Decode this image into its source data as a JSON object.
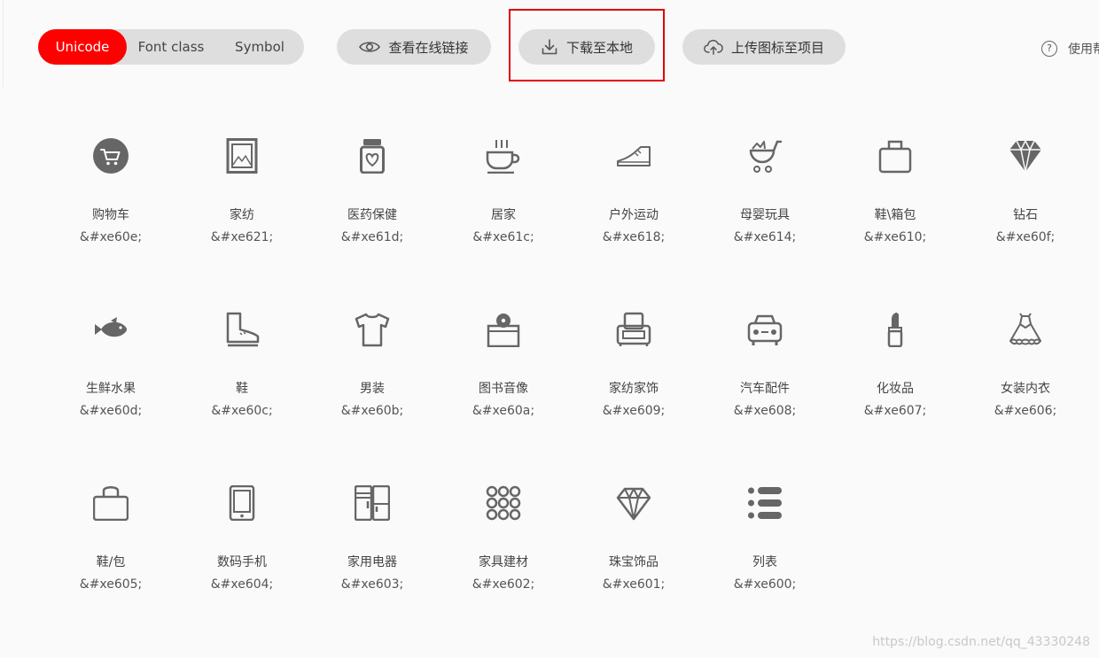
{
  "tabs": [
    "Unicode",
    "Font class",
    "Symbol"
  ],
  "active_tab": "Unicode",
  "actions": {
    "view_online_link": "查看在线链接",
    "download_local": "下载至本地",
    "upload_to_project": "上传图标至项目"
  },
  "help": "使用帮助",
  "icons": [
    {
      "name": "购物车",
      "code": "&#xe60e;",
      "icon": "shopping-cart-icon"
    },
    {
      "name": "家纺",
      "code": "&#xe621;",
      "icon": "framed-picture-icon"
    },
    {
      "name": "医药保健",
      "code": "&#xe61d;",
      "icon": "medicine-jar-icon"
    },
    {
      "name": "居家",
      "code": "&#xe61c;",
      "icon": "coffee-cup-icon"
    },
    {
      "name": "户外运动",
      "code": "&#xe618;",
      "icon": "sneaker-icon"
    },
    {
      "name": "母婴玩具",
      "code": "&#xe614;",
      "icon": "baby-stroller-icon"
    },
    {
      "name": "鞋\\箱包",
      "code": "&#xe610;",
      "icon": "handbag-icon"
    },
    {
      "name": "钻石",
      "code": "&#xe60f;",
      "icon": "diamond-filled-icon"
    },
    {
      "name": "生鲜水果",
      "code": "&#xe60d;",
      "icon": "fish-icon"
    },
    {
      "name": "鞋",
      "code": "&#xe60c;",
      "icon": "boot-icon"
    },
    {
      "name": "男装",
      "code": "&#xe60b;",
      "icon": "t-shirt-icon"
    },
    {
      "name": "图书音像",
      "code": "&#xe60a;",
      "icon": "cd-box-icon"
    },
    {
      "name": "家纺家饰",
      "code": "&#xe609;",
      "icon": "armchair-icon"
    },
    {
      "name": "汽车配件",
      "code": "&#xe608;",
      "icon": "car-icon"
    },
    {
      "name": "化妆品",
      "code": "&#xe607;",
      "icon": "lipstick-icon"
    },
    {
      "name": "女装内衣",
      "code": "&#xe606;",
      "icon": "dress-icon"
    },
    {
      "name": "鞋/包",
      "code": "&#xe605;",
      "icon": "shopping-bag-icon"
    },
    {
      "name": "数码手机",
      "code": "&#xe604;",
      "icon": "mobile-phone-icon"
    },
    {
      "name": "家用电器",
      "code": "&#xe603;",
      "icon": "refrigerator-icon"
    },
    {
      "name": "家具建材",
      "code": "&#xe602;",
      "icon": "dot-grid-icon"
    },
    {
      "name": "珠宝饰品",
      "code": "&#xe601;",
      "icon": "diamond-outline-icon"
    },
    {
      "name": "列表",
      "code": "&#xe600;",
      "icon": "list-icon"
    }
  ],
  "watermark": "https://blog.csdn.net/qq_43330248",
  "colors": {
    "accent": "#ff0000",
    "button_bg": "#dedede",
    "icon": "#666666",
    "highlight": "#e00000"
  }
}
